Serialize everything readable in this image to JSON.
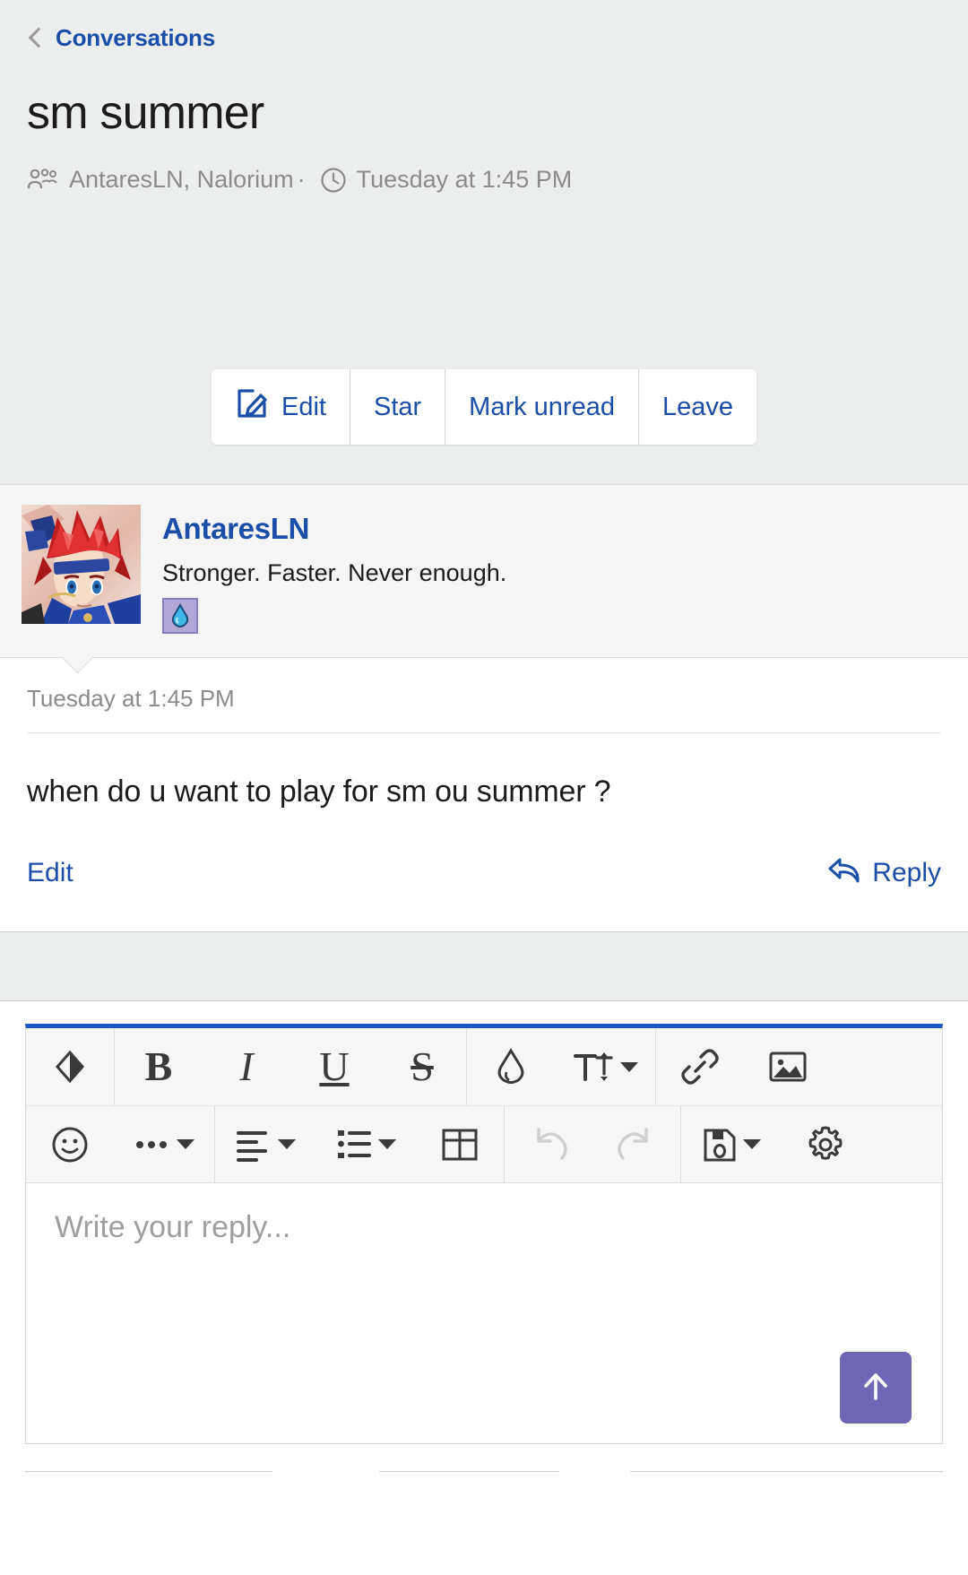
{
  "header": {
    "back_link": "Conversations",
    "back_icon": "chevron-left-icon",
    "title": "sm summer",
    "participants_icon": "users-icon",
    "participants": "AntaresLN, Nalorium",
    "separator": "·",
    "time_icon": "clock-icon",
    "timestamp": "Tuesday at 1:45 PM"
  },
  "actions": [
    {
      "label": "Edit",
      "icon": "compose-pencil-icon",
      "has_icon": true
    },
    {
      "label": "Star",
      "icon": "",
      "has_icon": false
    },
    {
      "label": "Mark unread",
      "icon": "",
      "has_icon": false
    },
    {
      "label": "Leave",
      "icon": "",
      "has_icon": false
    }
  ],
  "message": {
    "avatar_alt": "avatar",
    "username": "AntaresLN",
    "user_title": "Stronger. Faster. Never enough.",
    "badge_icon": "water-drop-badge-icon",
    "date": "Tuesday at 1:45 PM",
    "text": "when do u want to play for sm ou summer ?",
    "edit_label": "Edit",
    "reply_label": "Reply",
    "reply_icon": "reply-arrow-icon"
  },
  "editor": {
    "placeholder": "Write your reply...",
    "send_icon": "arrow-up-icon",
    "accent_color": "#1b56c4",
    "send_color": "#6f66b5",
    "toolbar_row1": [
      {
        "name": "remove-formatting-icon",
        "label": "",
        "disabled": false,
        "caret": false
      },
      {
        "name": "bold-icon",
        "label": "B",
        "disabled": false,
        "caret": false
      },
      {
        "name": "italic-icon",
        "label": "I",
        "disabled": false,
        "caret": false
      },
      {
        "name": "underline-icon",
        "label": "U",
        "disabled": false,
        "caret": false
      },
      {
        "name": "strikethrough-icon",
        "label": "S",
        "disabled": false,
        "caret": false
      },
      {
        "name": "text-color-drop-icon",
        "label": "",
        "disabled": false,
        "caret": false
      },
      {
        "name": "font-size-icon",
        "label": "",
        "disabled": false,
        "caret": true
      },
      {
        "name": "link-icon",
        "label": "",
        "disabled": false,
        "caret": false
      },
      {
        "name": "image-icon",
        "label": "",
        "disabled": false,
        "caret": false
      }
    ],
    "toolbar_row2": [
      {
        "name": "emoji-smiley-icon",
        "label": "",
        "disabled": false,
        "caret": false
      },
      {
        "name": "more-options-icon",
        "label": "",
        "disabled": false,
        "caret": true
      },
      {
        "name": "text-align-icon",
        "label": "",
        "disabled": false,
        "caret": true
      },
      {
        "name": "list-icon",
        "label": "",
        "disabled": false,
        "caret": true
      },
      {
        "name": "table-icon",
        "label": "",
        "disabled": false,
        "caret": false
      },
      {
        "name": "undo-icon",
        "label": "",
        "disabled": true,
        "caret": false
      },
      {
        "name": "redo-icon",
        "label": "",
        "disabled": true,
        "caret": false
      },
      {
        "name": "save-draft-icon",
        "label": "",
        "disabled": false,
        "caret": true
      },
      {
        "name": "gear-settings-icon",
        "label": "",
        "disabled": false,
        "caret": false
      }
    ]
  },
  "colors": {
    "link_blue": "#1b4ea8",
    "header_bg": "#eceded",
    "editor_accent": "#1b56c4",
    "send_purple": "#6f66b5"
  }
}
